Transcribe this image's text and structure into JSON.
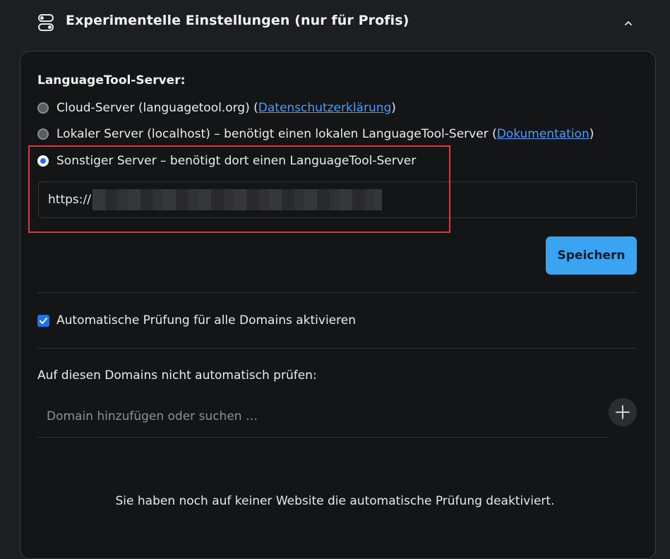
{
  "header": {
    "title": "Experimentelle Einstellungen (nur für Profis)",
    "icon": "toggles-icon",
    "collapse_icon": "chevron-up-icon"
  },
  "server": {
    "label": "LanguageTool-Server:",
    "options": [
      {
        "text": "Cloud-Server (languagetool.org) (",
        "link": "Datenschutzerklärung",
        "suffix": ")",
        "checked": false
      },
      {
        "text": "Lokaler Server (localhost) – benötigt einen lokalen LanguageTool-Server (",
        "link": "Dokumentation",
        "suffix": ")",
        "checked": false
      },
      {
        "text": "Sonstiger Server – benötigt dort einen LanguageTool-Server",
        "checked": true
      }
    ],
    "url_value": "https://",
    "save_label": "Speichern"
  },
  "auto_check": {
    "label": "Automatische Prüfung für alle Domains aktivieren",
    "checked": true
  },
  "domains": {
    "label": "Auf diesen Domains nicht automatisch prüfen:",
    "placeholder": "Domain hinzufügen oder suchen …",
    "add_icon": "plus-icon",
    "empty_message": "Sie haben noch auf keiner Website die automatische Prüfung deaktiviert."
  },
  "colors": {
    "accent": "#1a73e8",
    "button": "#3aa3f2",
    "link": "#4c9cff",
    "highlight": "#e0363d"
  }
}
